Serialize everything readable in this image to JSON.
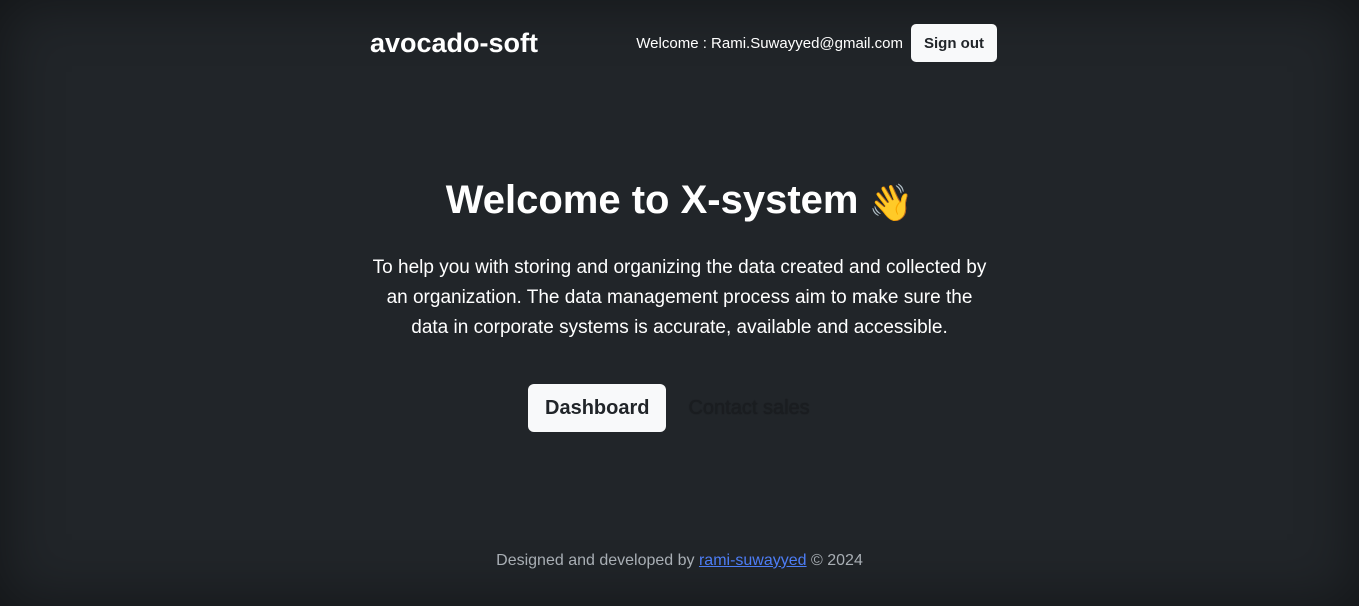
{
  "header": {
    "brand": "avocado-soft",
    "welcome": "Welcome : Rami.Suwayyed@gmail.com",
    "signout_label": "Sign out"
  },
  "hero": {
    "title": "Welcome to X-system",
    "wave_emoji": "👋",
    "lead": "To help you with storing and organizing the data created and collected by an organization. The data management process aim to make sure the data in corporate systems is accurate, available and accessible."
  },
  "actions": {
    "dashboard_label": "Dashboard",
    "contact_label": "Contact sales"
  },
  "footer": {
    "prefix": "Designed and developed by",
    "link_text": "rami-suwayyed",
    "suffix": "© 2024"
  },
  "colors": {
    "background": "#212529",
    "button_light": "#f8f9fa",
    "link": "#4d7df5"
  }
}
